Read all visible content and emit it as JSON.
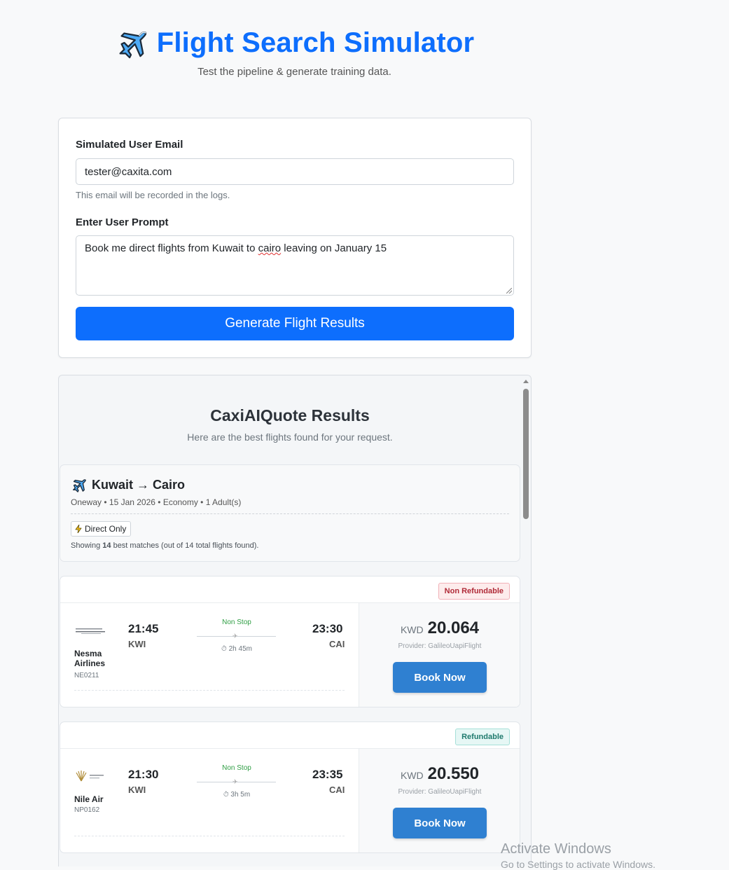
{
  "header": {
    "title": "Flight Search Simulator",
    "subtitle": "Test the pipeline & generate training data."
  },
  "form": {
    "email_label": "Simulated User Email",
    "email_value": "tester@caxita.com",
    "email_help": "This email will be recorded in the logs.",
    "prompt_label": "Enter User Prompt",
    "prompt_before": "Book me direct flights from Kuwait to ",
    "prompt_misspelled": "cairo",
    "prompt_after": " leaving on January 15",
    "generate_label": "Generate Flight Results"
  },
  "results": {
    "title": "CaxiAIQuote Results",
    "subtitle": "Here are the best flights found for your request.",
    "summary": {
      "route": "Kuwait → Cairo",
      "meta": "Oneway • 15 Jan 2026 • Economy • 1 Adult(s)",
      "filter_badge": "Direct Only",
      "showing_prefix": "Showing ",
      "showing_count": "14",
      "showing_suffix": " best matches (out of 14 total flights found)."
    },
    "flights": [
      {
        "refund": "Non Refundable",
        "airline": "Nesma Airlines",
        "flight_no": "NE0211",
        "dep_time": "21:45",
        "dep_code": "KWI",
        "arr_time": "23:30",
        "arr_code": "CAI",
        "stops": "Non Stop",
        "duration": "⏱ 2h 45m",
        "currency": "KWD",
        "price": "20.064",
        "provider": "Provider: GalileoUapiFlight",
        "book_label": "Book Now"
      },
      {
        "refund": "Refundable",
        "airline": "Nile Air",
        "flight_no": "NP0162",
        "dep_time": "21:30",
        "dep_code": "KWI",
        "arr_time": "23:35",
        "arr_code": "CAI",
        "stops": "Non Stop",
        "duration": "⏱ 3h 5m",
        "currency": "KWD",
        "price": "20.550",
        "provider": "Provider: GalileoUapiFlight",
        "book_label": "Book Now"
      }
    ]
  },
  "os": {
    "watermark": "Activate Windows",
    "watermark_sub": "Go to Settings to activate Windows."
  },
  "colors": {
    "accent": "#0d6efd",
    "book_button": "#2f80d1",
    "non_refundable": "#b02a37",
    "refundable": "#1f7a6d",
    "non_stop": "#2f9e44"
  }
}
